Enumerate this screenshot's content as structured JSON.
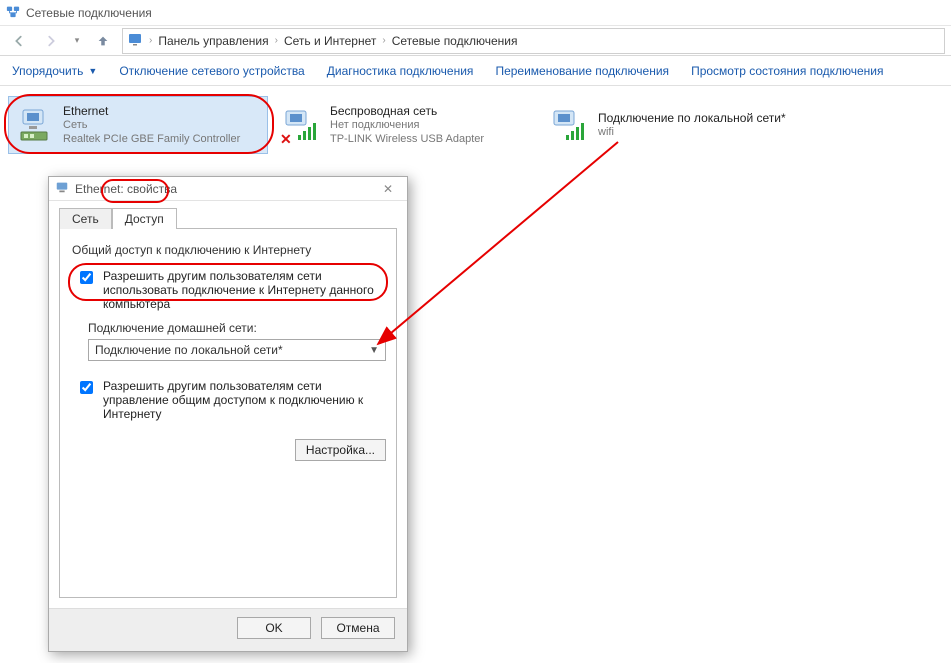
{
  "window": {
    "title": "Сетевые подключения"
  },
  "breadcrumb": {
    "root_icon": "control-panel-icon",
    "items": [
      "Панель управления",
      "Сеть и Интернет",
      "Сетевые подключения"
    ]
  },
  "toolbar": {
    "organize": "Упорядочить",
    "disable_device": "Отключение сетевого устройства",
    "diagnose": "Диагностика подключения",
    "rename": "Переименование подключения",
    "view_status": "Просмотр состояния подключения"
  },
  "connections": [
    {
      "name": "Ethernet",
      "status": "Сеть",
      "device": "Realtek PCIe GBE Family Controller",
      "kind": "wired",
      "disconnected": false,
      "selected": true
    },
    {
      "name": "Беспроводная сеть",
      "status": "Нет подключения",
      "device": "TP-LINK Wireless USB Adapter",
      "kind": "wireless",
      "disconnected": true,
      "selected": false
    },
    {
      "name": "Подключение по локальной сети*",
      "status": "wifi",
      "device": "",
      "kind": "wireless",
      "disconnected": false,
      "selected": false
    }
  ],
  "dialog": {
    "title": "Ethernet: свойства",
    "tabs": {
      "network": "Сеть",
      "sharing": "Доступ"
    },
    "active_tab": "sharing",
    "group_label": "Общий доступ к подключению к Интернету",
    "allow_share_label": "Разрешить другим пользователям сети использовать подключение к Интернету данного компьютера",
    "allow_share_checked": true,
    "home_conn_label": "Подключение домашней сети:",
    "home_conn_value": "Подключение по локальной сети*",
    "allow_control_label": "Разрешить другим пользователям сети управление общим доступом к подключению к Интернету",
    "allow_control_checked": true,
    "settings_btn": "Настройка...",
    "ok": "OK",
    "cancel": "Отмена"
  },
  "colors": {
    "link": "#1a5aad",
    "highlight": "#e60000"
  }
}
